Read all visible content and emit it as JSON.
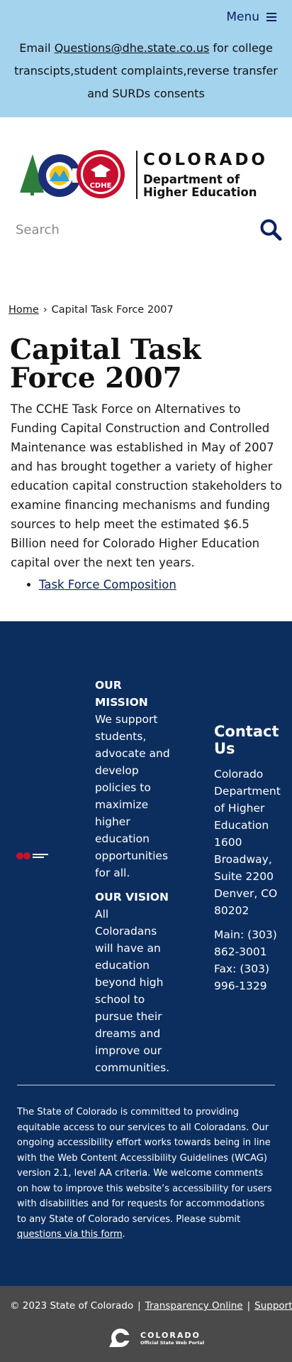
{
  "header": {
    "menu_label": "Menu",
    "notice_prefix": "Email ",
    "notice_email": "Questions@dhe.state.co.us",
    "notice_suffix": " for college transcipts,student complaints,reverse transfer and SURDs consents"
  },
  "logo": {
    "state_name": "COLORADO",
    "dept_line1": "Department of",
    "dept_line2": "Higher Education",
    "badge": "CDHE"
  },
  "search": {
    "placeholder": "Search"
  },
  "breadcrumb": {
    "home": "Home",
    "separator": "›",
    "current": "Capital Task Force 2007"
  },
  "main": {
    "title": "Capital Task Force 2007",
    "body": "The CCHE Task Force on Alternatives to Funding Capital Construction and Controlled Maintenance was established in May of 2007 and has brought together a variety of higher education capital construction stakeholders to examine financing mechanisms and funding sources to help meet the estimated $6.5 Billion need for Colorado Higher Education capital over the next ten years.",
    "links": [
      "Task Force Composition"
    ]
  },
  "footer": {
    "mission_heading": "OUR MISSION",
    "mission_text": "We support students, advocate and develop policies to maximize higher education opportunities for all.",
    "vision_heading": "OUR VISION",
    "vision_text": "All Coloradans will have an education beyond high school to pursue their dreams and improve our communities.",
    "contact_heading": "Contact Us",
    "contact_address": "Colorado Department of Higher Education 1600 Broadway, Suite 2200 Denver, CO 80202",
    "contact_phone": "Main: (303) 862-3001 Fax: (303) 996-1329",
    "accessibility_text": "The State of Colorado is committed to providing equitable access to our services to all Coloradans. Our ongoing accessibility effort works towards being in line with the Web Content Accessibility Guidelines (WCAG) version 2.1, level AA criteria. We welcome comments on how to improve this website’s accessibility for users with disabilities and for requests for accommodations to any State of Colorado services. Please submit ",
    "accessibility_link": "questions via this form",
    "accessibility_end": "."
  },
  "bottom": {
    "copyright": "© 2023 State of Colorado",
    "pipe": "|",
    "transparency": "Transparency Online",
    "support": "Support",
    "portal_name": "COLORADO",
    "portal_sub": "Official State Web Portal"
  },
  "colors": {
    "banner": "#a4d3ee",
    "navy": "#0c2e5e",
    "link": "#0b2060",
    "bottom_bar": "#4a4a4a"
  }
}
